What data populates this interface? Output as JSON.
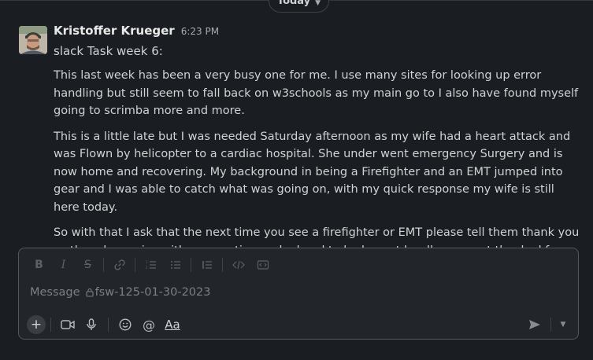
{
  "day_divider": {
    "label": "Today"
  },
  "message": {
    "author": "Kristoffer Krueger",
    "time": "6:23 PM",
    "title_line": "slack Task week 6:",
    "paragraphs": [
      "This last week has been a very busy one for me. I use many sites for looking up error handling but still seem to fall back on w3schools as my main go to I also have found myself going to scrimba more and more.",
      "This is a little late but I was needed Saturday afternoon as my wife had a heart attack and was Flown by helicopter to a cardiac hospital. She under went emergency Surgery and is now home and recovering. My background in being a Firefighter and an EMT jumped into gear and I was able to catch what was going on, with my quick response my wife is still here today.",
      "So with that I ask that the next time you see a firefighter or EMT please tell them thank you as they do service with no questions asked and to be honest hardly ever get thanked for the work they do."
    ]
  },
  "composer": {
    "placeholder_prefix": "Message",
    "channel": "fsw-125-01-30-2023",
    "format_aa": "Aa",
    "formatting_icons": [
      "bold-icon",
      "italic-icon",
      "strikethrough-icon",
      "link-icon",
      "ordered-list-icon",
      "bulleted-list-icon",
      "blockquote-icon",
      "code-icon",
      "code-block-icon"
    ]
  }
}
